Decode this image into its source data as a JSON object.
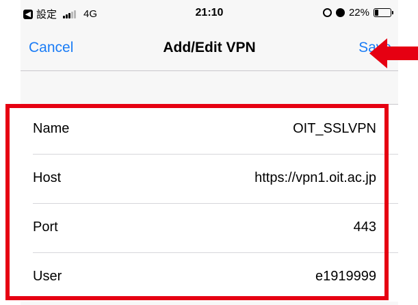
{
  "status_bar": {
    "back_label": "設定",
    "network": "4G",
    "time": "21:10",
    "battery_percent": "22%",
    "battery_level": 0.22
  },
  "nav": {
    "cancel_label": "Cancel",
    "title": "Add/Edit VPN",
    "save_label": "Save"
  },
  "form": {
    "rows": [
      {
        "label": "Name",
        "value": "OIT_SSLVPN"
      },
      {
        "label": "Host",
        "value": "https://vpn1.oit.ac.jp"
      },
      {
        "label": "Port",
        "value": "443"
      },
      {
        "label": "User",
        "value": "e1919999"
      }
    ]
  },
  "colors": {
    "accent": "#1a7cf6",
    "annotation": "#e60012"
  },
  "icons": {
    "back": "back-chevron-icon",
    "signal": "signal-bars-icon",
    "orientation_lock": "orientation-lock-icon",
    "alarm": "alarm-icon",
    "battery": "battery-icon",
    "arrow": "red-arrow-icon"
  }
}
